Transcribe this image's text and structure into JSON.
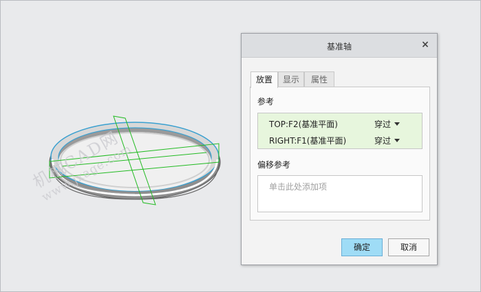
{
  "watermark": {
    "line1": "机械CAD网",
    "line2": "www.jxage.com"
  },
  "dialog": {
    "title": "基准轴",
    "close_glyph": "×",
    "tabs": [
      {
        "label": "放置",
        "active": true
      },
      {
        "label": "显示",
        "active": false
      },
      {
        "label": "属性",
        "active": false
      }
    ],
    "references_label": "参考",
    "references": [
      {
        "name": "TOP:F2(基准平面)",
        "constraint": "穿过"
      },
      {
        "name": "RIGHT:F1(基准平面)",
        "constraint": "穿过"
      }
    ],
    "offset_label": "偏移参考",
    "offset_placeholder": "单击此处添加项",
    "ok_label": "确定",
    "cancel_label": "取消"
  },
  "colors": {
    "reference_highlight": "#e7f6dd",
    "primary_button": "#9fdcf6",
    "datum_green": "#22bb22",
    "edge_cyan": "#3aa0d0"
  }
}
